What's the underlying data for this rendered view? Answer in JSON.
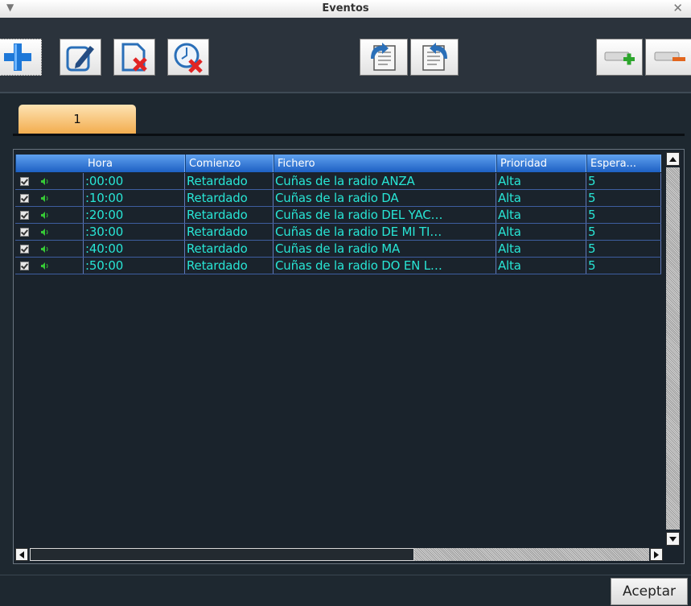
{
  "window": {
    "title": "Eventos",
    "menu_glyph": "▼",
    "close_glyph": "✕"
  },
  "toolbar": {
    "buttons": [
      {
        "name": "add-event-button",
        "icon": "plus-icon"
      },
      {
        "name": "edit-event-button",
        "icon": "edit-icon"
      },
      {
        "name": "delete-event-button",
        "icon": "delete-file-icon"
      },
      {
        "name": "delete-timed-event-button",
        "icon": "clock-delete-icon"
      },
      {
        "name": "import-button",
        "icon": "import-icon"
      },
      {
        "name": "export-button",
        "icon": "export-icon"
      },
      {
        "name": "add-block-button",
        "icon": "add-block-icon"
      },
      {
        "name": "remove-block-button",
        "icon": "remove-block-icon"
      }
    ]
  },
  "tabs": [
    {
      "label": "1"
    }
  ],
  "grid": {
    "columns": [
      "Hora",
      "Comienzo",
      "Fichero",
      "Prioridad",
      "Espera..."
    ],
    "rows": [
      {
        "hora": ":00:00",
        "comienzo": "Retardado",
        "fichero": "Cuñas de la radio ANZA",
        "prioridad": "Alta",
        "espera": "5"
      },
      {
        "hora": ":10:00",
        "comienzo": "Retardado",
        "fichero": "Cuñas de la radio DA",
        "prioridad": "Alta",
        "espera": "5"
      },
      {
        "hora": ":20:00",
        "comienzo": "Retardado",
        "fichero": "Cuñas de la radio DEL YAC…",
        "prioridad": "Alta",
        "espera": "5"
      },
      {
        "hora": ":30:00",
        "comienzo": "Retardado",
        "fichero": "Cuñas de la radio DE MI TI…",
        "prioridad": "Alta",
        "espera": "5"
      },
      {
        "hora": ":40:00",
        "comienzo": "Retardado",
        "fichero": "Cuñas de la radio MA",
        "prioridad": "Alta",
        "espera": "5"
      },
      {
        "hora": ":50:00",
        "comienzo": "Retardado",
        "fichero": "Cuñas de la radio DO EN L…",
        "prioridad": "Alta",
        "espera": "5"
      }
    ]
  },
  "footer": {
    "accept_label": "Aceptar"
  },
  "colors": {
    "cell_text": "#28e5d5",
    "header": "#2f74d8",
    "tab": "#f3ad4f",
    "background": "#1e2830"
  }
}
